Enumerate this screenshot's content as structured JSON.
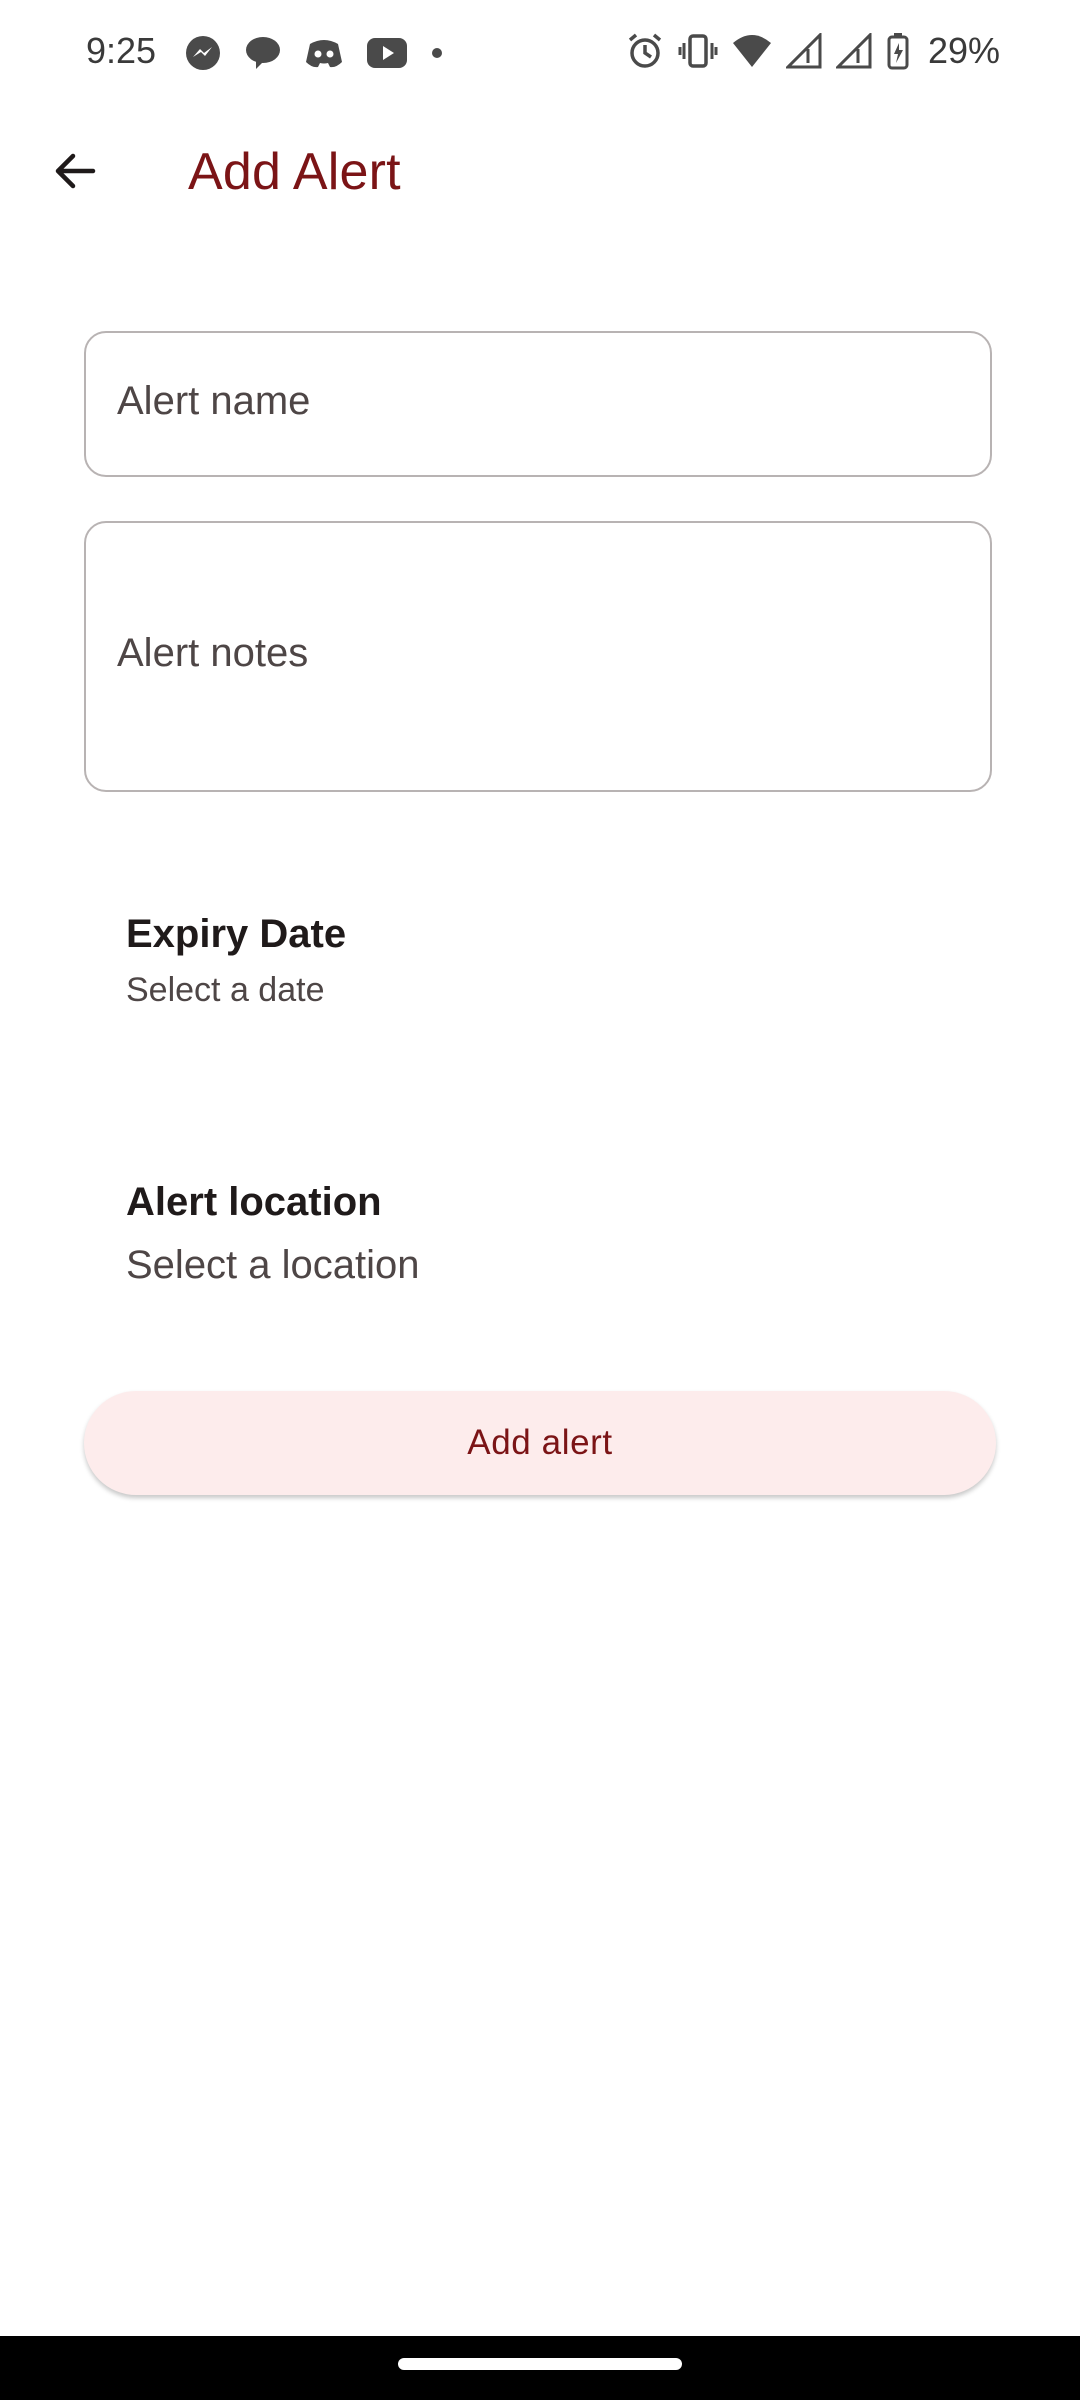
{
  "status_bar": {
    "time": "9:25",
    "battery": "29%",
    "left_icons": [
      "messenger-icon",
      "chat-icon",
      "discord-icon",
      "youtube-icon",
      "dot-icon"
    ],
    "right_icons": [
      "alarm-icon",
      "vibrate-icon",
      "wifi-icon",
      "signal-icon",
      "signal-icon",
      "battery-charging-icon"
    ]
  },
  "app_bar": {
    "back_icon": "arrow-back-icon",
    "title": "Add Alert"
  },
  "form": {
    "name_placeholder": "Alert name",
    "notes_placeholder": "Alert notes",
    "expiry": {
      "title": "Expiry Date",
      "subtitle": "Select a date"
    },
    "location": {
      "title": "Alert location",
      "subtitle": "Select a location"
    },
    "submit_label": "Add alert"
  },
  "colors": {
    "accent": "#7B1416",
    "button_bg": "#FDECEC",
    "outline": "#B8B3B3"
  }
}
